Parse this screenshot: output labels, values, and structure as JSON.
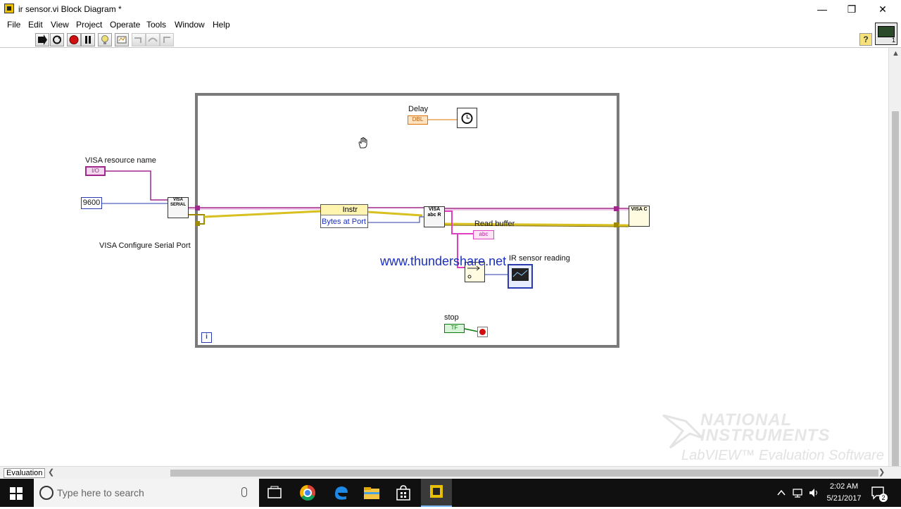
{
  "window": {
    "title": "ir sensor.vi Block Diagram *",
    "minimize": "—",
    "restore": "❒",
    "close": "✕"
  },
  "menu": [
    "File",
    "Edit",
    "View",
    "Project",
    "Operate",
    "Tools",
    "Window",
    "Help"
  ],
  "toolbar": {
    "help": "?"
  },
  "vi_icon": {
    "badge": "1"
  },
  "diagram": {
    "visa_resource_label": "VISA resource name",
    "visa_resource_tag": "I/O",
    "baud_constant": "9600",
    "configure_label": "VISA Configure Serial Port",
    "configure_node_text": "VISA SERIAL",
    "property_instr": "Instr",
    "property_bytes": "Bytes at Port",
    "read_node_text": "VISA abc R",
    "read_buffer_label": "Read buffer",
    "read_buffer_tag": "abc",
    "sensor_label": "IR sensor reading",
    "delay_label": "Delay",
    "delay_tag": "DBL",
    "stop_label": "stop",
    "stop_tag": "TF",
    "close_node_text": "VISA C",
    "loop_iteration": "i",
    "watermark": "www.thundershare.net"
  },
  "statusbar": {
    "label": "Evaluation"
  },
  "branding": {
    "line1": "NATIONAL",
    "line2": "INSTRUMENTS",
    "line3": "LabVIEW™ Evaluation Software"
  },
  "taskbar": {
    "search_placeholder": "Type here to search",
    "time": "2:02 AM",
    "date": "5/21/2017",
    "notification_count": "2"
  }
}
